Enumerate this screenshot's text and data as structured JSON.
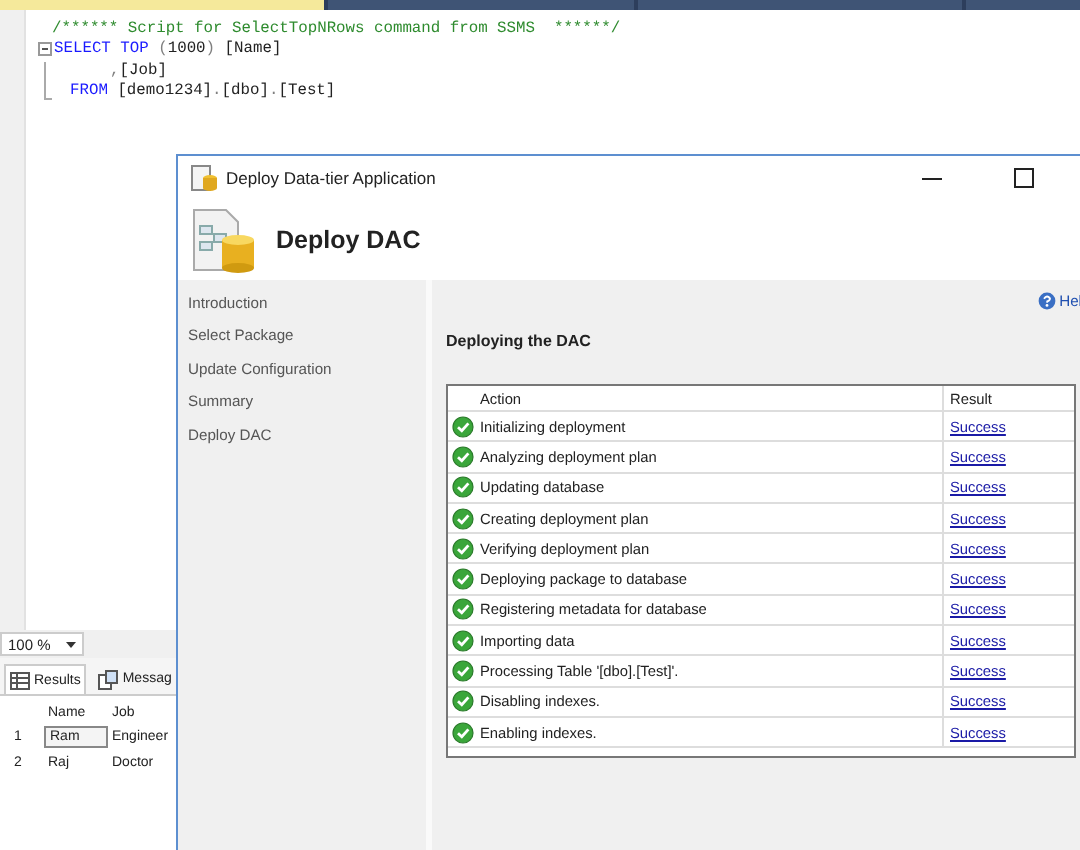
{
  "document_tabs": [
    {
      "selected": true
    },
    {
      "selected": false
    },
    {
      "selected": false
    },
    {
      "selected": false
    }
  ],
  "editor": {
    "lines": [
      {
        "kind": "comment",
        "tokens": [
          {
            "kind": "comment",
            "text": "/****** Script for SelectTopNRows command from SSMS  ******/"
          }
        ]
      },
      {
        "kind": "statement",
        "tokens": [
          {
            "kind": "keyword",
            "text": "SELECT TOP "
          },
          {
            "kind": "operator",
            "text": "("
          },
          {
            "kind": "plain",
            "text": "1000"
          },
          {
            "kind": "operator",
            "text": ")"
          },
          {
            "kind": "plain",
            "text": " [Name]"
          }
        ]
      },
      {
        "kind": "continuation",
        "tokens": [
          {
            "kind": "operator",
            "text": ","
          },
          {
            "kind": "plain",
            "text": "[Job]"
          }
        ]
      },
      {
        "kind": "clause",
        "tokens": [
          {
            "kind": "keyword",
            "text": "FROM "
          },
          {
            "kind": "plain",
            "text": "[demo1234]"
          },
          {
            "kind": "operator",
            "text": "."
          },
          {
            "kind": "plain",
            "text": "[dbo]"
          },
          {
            "kind": "operator",
            "text": "."
          },
          {
            "kind": "plain",
            "text": "[Test]"
          }
        ]
      }
    ]
  },
  "zoom": {
    "value": "100 %"
  },
  "results": {
    "tabs": [
      {
        "label": "Results",
        "selected": true
      },
      {
        "label": "Messag",
        "selected": false
      }
    ],
    "columns": [
      "Name",
      "Job"
    ],
    "rows": [
      {
        "number": "1",
        "cells": [
          {
            "text": "Ram",
            "selected": true
          },
          {
            "text": "Engineer",
            "selected": false
          }
        ]
      },
      {
        "number": "2",
        "cells": [
          {
            "text": "Raj",
            "selected": false
          },
          {
            "text": "Doctor",
            "selected": false
          }
        ]
      }
    ]
  },
  "dialog": {
    "title": "Deploy Data-tier Application",
    "heading": "Deploy DAC",
    "steps": [
      "Introduction",
      "Select Package",
      "Update Configuration",
      "Summary",
      "Deploy DAC"
    ],
    "help": "Hel",
    "section_title": "Deploying the DAC",
    "columns": [
      "Action",
      "Result"
    ],
    "rows": [
      {
        "kind": "success",
        "action": "Initializing deployment",
        "result": "Success"
      },
      {
        "kind": "success",
        "action": "Analyzing deployment plan",
        "result": "Success"
      },
      {
        "kind": "success",
        "action": "Updating database",
        "result": "Success"
      },
      {
        "kind": "success",
        "action": "Creating deployment plan",
        "result": "Success"
      },
      {
        "kind": "success",
        "action": "Verifying deployment plan",
        "result": "Success"
      },
      {
        "kind": "success",
        "action": "Deploying package to database",
        "result": "Success"
      },
      {
        "kind": "success",
        "action": "Registering metadata for database",
        "result": "Success"
      },
      {
        "kind": "success",
        "action": "Importing data",
        "result": "Success"
      },
      {
        "kind": "success",
        "action": "Processing Table '[dbo].[Test]'.",
        "result": "Success"
      },
      {
        "kind": "success",
        "action": "Disabling indexes.",
        "result": "Success"
      },
      {
        "kind": "success",
        "action": "Enabling indexes.",
        "result": "Success"
      }
    ]
  }
}
